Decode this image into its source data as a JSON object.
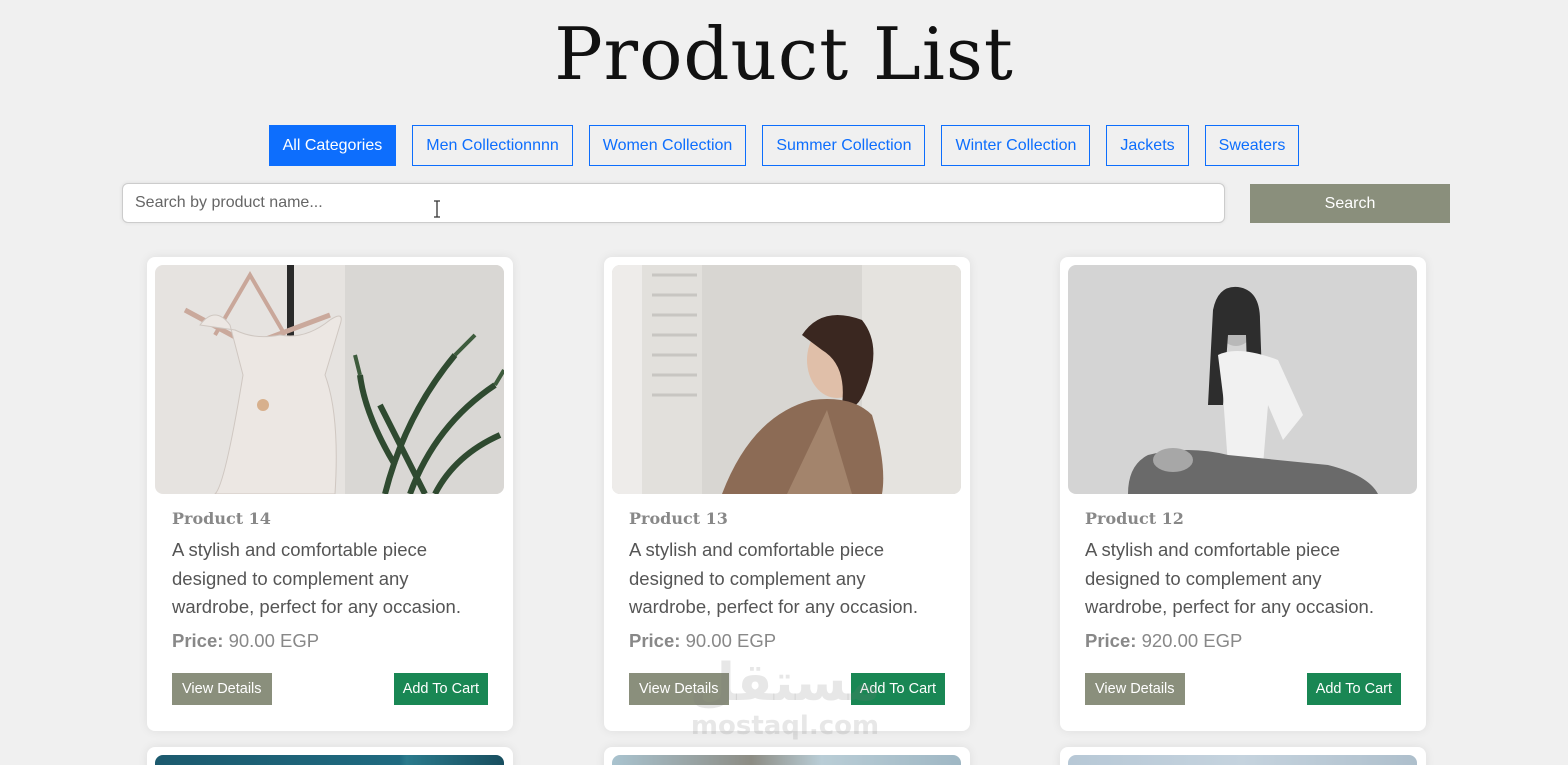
{
  "header": {
    "title": "Product List"
  },
  "filters": [
    {
      "label": "All Categories",
      "active": true
    },
    {
      "label": "Men Collectionnnn",
      "active": false
    },
    {
      "label": "Women Collection",
      "active": false
    },
    {
      "label": "Summer Collection",
      "active": false
    },
    {
      "label": "Winter Collection",
      "active": false
    },
    {
      "label": "Jackets",
      "active": false
    },
    {
      "label": "Sweaters",
      "active": false
    }
  ],
  "search": {
    "placeholder": "Search by product name...",
    "value": "",
    "button_label": "Search"
  },
  "products": [
    {
      "name": "Product 14",
      "description": "A stylish and comfortable piece designed to complement any wardrobe, perfect for any occasion.",
      "price_label": "Price:",
      "price": "90.00 EGP",
      "view_label": "View Details",
      "cart_label": "Add To Cart",
      "image": "white-dress-on-hanger"
    },
    {
      "name": "Product 13",
      "description": "A stylish and comfortable piece designed to complement any wardrobe, perfect for any occasion.",
      "price_label": "Price:",
      "price": "90.00 EGP",
      "view_label": "View Details",
      "cart_label": "Add To Cart",
      "image": "woman-in-brown-blazer"
    },
    {
      "name": "Product 12",
      "description": "A stylish and comfortable piece designed to complement any wardrobe, perfect for any occasion.",
      "price_label": "Price:",
      "price": "920.00 EGP",
      "view_label": "View Details",
      "cart_label": "Add To Cart",
      "image": "woman-in-white-shirt-bw"
    }
  ],
  "watermark": {
    "logo": "مستقل",
    "domain": "mostaql.com"
  },
  "colors": {
    "primary": "#0d6efd",
    "olive": "#8a8f7c",
    "green": "#198754",
    "background": "#f0f0f0"
  }
}
